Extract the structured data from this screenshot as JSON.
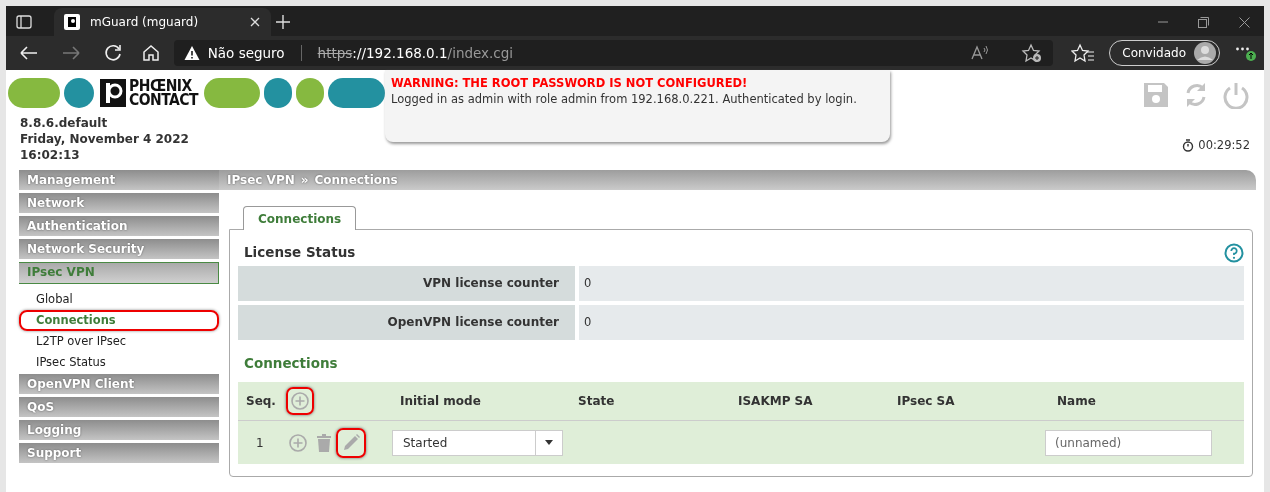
{
  "browser": {
    "tab_title": "mGuard (mguard)",
    "security_label": "Não seguro",
    "url_scheme": "https",
    "url_host": "://192.168.0.1",
    "url_path": "/index.cgi",
    "profile": "Convidado"
  },
  "header": {
    "logo_line1": "PHŒNIX",
    "logo_line2": "CONTACT",
    "warning": "WARNING: THE ROOT PASSWORD IS NOT CONFIGURED!",
    "login_info": "Logged in as admin with role admin from 192.168.0.221. Authenticated by login.",
    "version": "8.8.6.default",
    "date": "Friday, November 4 2022",
    "time": "16:02:13",
    "session_timer": "00:29:52"
  },
  "sidebar": {
    "items": [
      {
        "label": "Management",
        "selected": false
      },
      {
        "label": "Network",
        "selected": false
      },
      {
        "label": "Authentication",
        "selected": false
      },
      {
        "label": "Network Security",
        "selected": false
      },
      {
        "label": "IPsec VPN",
        "selected": true,
        "children": [
          {
            "label": "Global",
            "selected": false,
            "annotated": false
          },
          {
            "label": "Connections",
            "selected": true,
            "annotated": true
          },
          {
            "label": "L2TP over IPsec",
            "selected": false,
            "annotated": false
          },
          {
            "label": "IPsec Status",
            "selected": false,
            "annotated": false
          }
        ]
      },
      {
        "label": "OpenVPN Client",
        "selected": false
      },
      {
        "label": "QoS",
        "selected": false
      },
      {
        "label": "Logging",
        "selected": false
      },
      {
        "label": "Support",
        "selected": false
      }
    ]
  },
  "breadcrumb": {
    "section": "IPsec VPN",
    "separator": "»",
    "page": "Connections"
  },
  "tabs": [
    {
      "label": "Connections",
      "selected": true
    }
  ],
  "license_status": {
    "title": "License Status",
    "rows": [
      {
        "label": "VPN license counter",
        "value": "0"
      },
      {
        "label": "OpenVPN license counter",
        "value": "0"
      }
    ]
  },
  "connections": {
    "title": "Connections",
    "columns": [
      "Seq.",
      "Initial mode",
      "State",
      "ISAKMP SA",
      "IPsec SA",
      "Name"
    ],
    "add_annotated": true,
    "rows": [
      {
        "seq": "1",
        "initial_mode": "Started",
        "name_placeholder": "(unnamed)",
        "edit_annotated": true
      }
    ]
  }
}
